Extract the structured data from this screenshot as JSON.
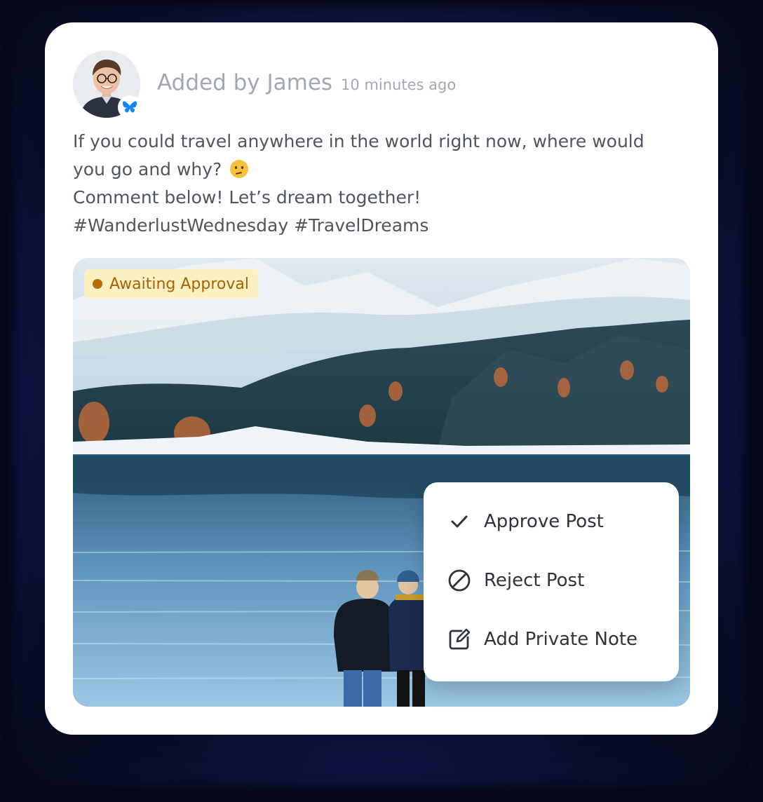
{
  "post": {
    "author_line": "Added by James",
    "timestamp": "10 minutes ago",
    "text_lines": [
      "If you could travel anywhere in the world right now, where would",
      "you go and why?",
      "Comment below! Let’s dream together!",
      "#WanderlustWednesday #TravelDreams"
    ],
    "emoji": "thinking-face-emoji",
    "network_badge_icon": "butterfly-icon"
  },
  "media": {
    "status_badge": "Awaiting Approval",
    "status_color": "#b86b07"
  },
  "menu": {
    "items": [
      {
        "label": "Approve Post",
        "icon": "check-icon"
      },
      {
        "label": "Reject Post",
        "icon": "ban-icon"
      },
      {
        "label": "Add Private Note",
        "icon": "edit-note-icon"
      }
    ]
  },
  "colors": {
    "badge_bg": "#fdf0c2",
    "brand_blue": "#1185fe",
    "muted_text": "#a2a7b1",
    "body_text": "#4f5561"
  }
}
